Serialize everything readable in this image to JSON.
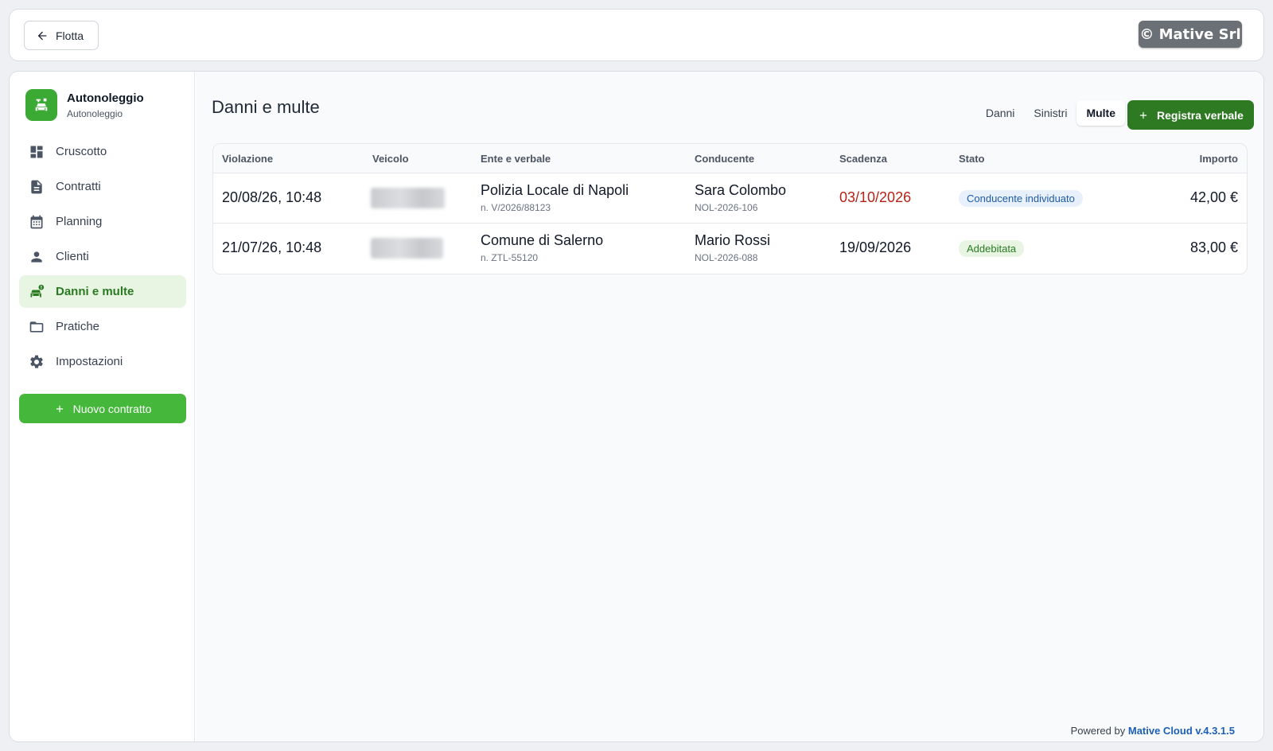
{
  "topbar": {
    "back_label": "Flotta",
    "logo_text": "© Mative Srl"
  },
  "sidebar": {
    "brand_title": "Autonoleggio",
    "brand_subtitle": "Autonoleggio",
    "items": [
      {
        "label": "Cruscotto",
        "icon": "dashboard-icon"
      },
      {
        "label": "Contratti",
        "icon": "document-icon"
      },
      {
        "label": "Planning",
        "icon": "calendar-icon"
      },
      {
        "label": "Clienti",
        "icon": "person-icon"
      },
      {
        "label": "Danni e multe",
        "icon": "car-alert-icon",
        "active": true
      },
      {
        "label": "Pratiche",
        "icon": "folder-icon"
      },
      {
        "label": "Impostazioni",
        "icon": "gear-icon"
      }
    ],
    "new_contract_label": "Nuovo contratto"
  },
  "main": {
    "title": "Danni e multe",
    "tabs": [
      {
        "label": "Danni"
      },
      {
        "label": "Sinistri"
      },
      {
        "label": "Multe",
        "active": true
      }
    ],
    "add_button_label": "Registra verbale",
    "table": {
      "headers": [
        "Violazione",
        "Veicolo",
        "Ente e verbale",
        "Conducente",
        "Scadenza",
        "Stato",
        "Importo"
      ],
      "rows": [
        {
          "violazione": "20/08/26, 10:48",
          "ente": "Polizia Locale di Napoli",
          "verbale": "n. V/2026/88123",
          "conducente": "Sara Colombo",
          "contratto": "NOL-2026-106",
          "scadenza": "03/10/2026",
          "scadenza_overdue": true,
          "stato": "Conducente individuato",
          "importo": "42,00 €"
        },
        {
          "violazione": "21/07/26, 10:48",
          "ente": "Comune di Salerno",
          "verbale": "n. ZTL-55120",
          "conducente": "Mario Rossi",
          "contratto": "NOL-2026-088",
          "scadenza": "19/09/2026",
          "scadenza_overdue": false,
          "stato": "Addebitata",
          "importo": "83,00 €"
        }
      ]
    }
  },
  "footer": {
    "prefix": "Powered by",
    "brand": "Mative Cloud v.4.3.1.5"
  },
  "colors": {
    "accent": "#45b83b",
    "primary_dark": "#2d7a22",
    "overdue": "#b42318"
  }
}
